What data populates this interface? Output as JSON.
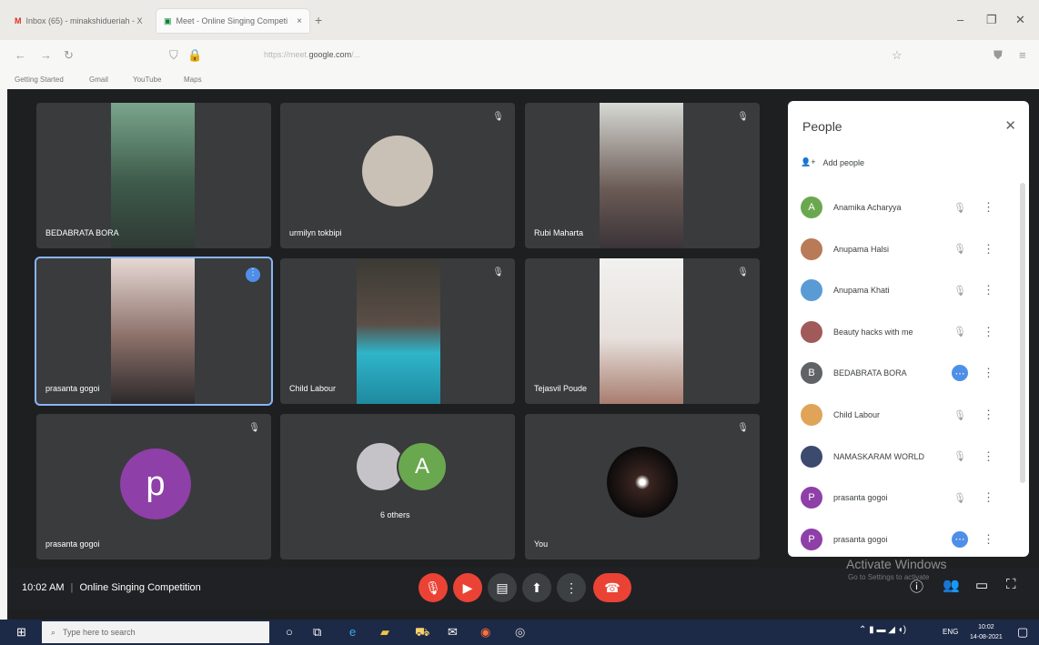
{
  "browser": {
    "tabs": [
      {
        "label": "Inbox (65) - minakshidueriah - X"
      },
      {
        "label": "Meet - Online Singing Competi",
        "sub": "Camera"
      }
    ],
    "new_tab": "+",
    "window": {
      "minimize": "–",
      "restore": "❐",
      "close": "✕"
    },
    "url": {
      "prefix": "https://meet.",
      "domain": "google.com",
      "suffix": "/..."
    },
    "bookmarks": [
      "Getting Started",
      "Gmail",
      "YouTube",
      "Maps"
    ]
  },
  "tiles": [
    {
      "name": "BEDABRATA BORA",
      "type": "video"
    },
    {
      "name": "urmilyn tokbipi",
      "type": "video"
    },
    {
      "name": "Rubi Maharta",
      "type": "video"
    },
    {
      "name": "prasanta gogoi",
      "type": "video",
      "active": true
    },
    {
      "name": "Child Labour",
      "type": "video"
    },
    {
      "name": "Tejasvil Poude",
      "type": "video"
    },
    {
      "name": "prasanta gogoi",
      "type": "avatar",
      "letter": "p"
    },
    {
      "name": "6 others",
      "type": "others",
      "letter": "A"
    },
    {
      "name": "You",
      "type": "self"
    }
  ],
  "people_panel": {
    "title": "People",
    "add_label": "Add people",
    "people": [
      {
        "name": "Anamika Acharyya",
        "initial": "A",
        "color": "#6aa84f",
        "speaking": false
      },
      {
        "name": "Anupama Halsi",
        "initial": "",
        "color": "#b97a57",
        "speaking": false
      },
      {
        "name": "Anupama Khati",
        "initial": "",
        "color": "#5a9bd5",
        "speaking": false
      },
      {
        "name": "Beauty hacks with me",
        "initial": "",
        "color": "#a05a5a",
        "speaking": false
      },
      {
        "name": "BEDABRATA BORA",
        "initial": "B",
        "color": "#5f6368",
        "speaking": true
      },
      {
        "name": "Child Labour",
        "initial": "",
        "color": "#e0a458",
        "speaking": false
      },
      {
        "name": "NAMASKARAM WORLD",
        "initial": "",
        "color": "#3c4a6e",
        "speaking": false
      },
      {
        "name": "prasanta gogoi",
        "initial": "P",
        "color": "#8e3fa8",
        "speaking": false
      },
      {
        "name": "prasanta gogoi",
        "initial": "P",
        "color": "#8e3fa8",
        "speaking": true
      }
    ]
  },
  "bottom_bar": {
    "time": "10:02 AM",
    "meeting_name": "Online Singing Competition"
  },
  "watermark": {
    "title": "Activate Windows",
    "sub": "Go to Settings to activate"
  },
  "taskbar": {
    "search_placeholder": "Type here to search",
    "clock_time": "10:02",
    "clock_date": "14-08-2021",
    "lang": "ENG"
  },
  "colors": {
    "end_call": "#ea4335",
    "speaking": "#4f8fe8",
    "tile_bg": "#3a3b3d",
    "meet_bg": "#1e1f21"
  }
}
